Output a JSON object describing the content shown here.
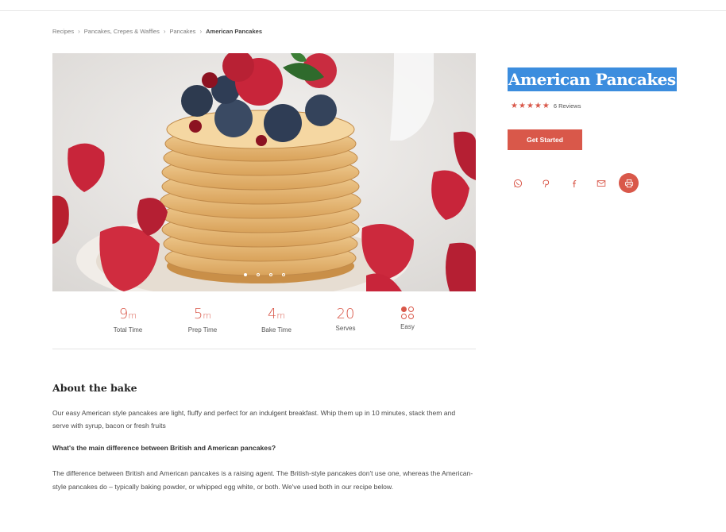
{
  "breadcrumb": {
    "items": [
      "Recipes",
      "Pancakes, Crepes & Waffles",
      "Pancakes"
    ],
    "current": "American Pancakes"
  },
  "recipe": {
    "title": "American Pancakes",
    "rating": 5,
    "reviews_label": "6 Reviews",
    "cta_label": "Get Started"
  },
  "share": {
    "icons": [
      "whatsapp-icon",
      "pinterest-icon",
      "facebook-icon",
      "email-icon",
      "print-icon"
    ]
  },
  "carousel": {
    "slides": 4,
    "active_index": 0
  },
  "stats": {
    "total": {
      "value": "9",
      "unit": "m",
      "label": "Total Time"
    },
    "prep": {
      "value": "5",
      "unit": "m",
      "label": "Prep Time"
    },
    "bake": {
      "value": "4",
      "unit": "m",
      "label": "Bake Time"
    },
    "serves": {
      "value": "20",
      "label": "Serves"
    },
    "difficulty": {
      "label": "Easy",
      "level": 1,
      "max": 4
    }
  },
  "about": {
    "title": "About the bake",
    "intro": "Our easy American style pancakes are light, fluffy and perfect for an indulgent breakfast. Whip them up in 10 minutes, stack them and serve with syrup, bacon or fresh fruits",
    "question": "What's the main difference between British and American pancakes?",
    "answer": "The difference between British and American pancakes is a raising agent. The British-style pancakes don't use one, whereas the American-style pancakes do – typically baking powder, or whipped egg white, or both. We've used both in our recipe below."
  },
  "colors": {
    "accent": "#d9584a",
    "selection": "#3c8dde"
  }
}
